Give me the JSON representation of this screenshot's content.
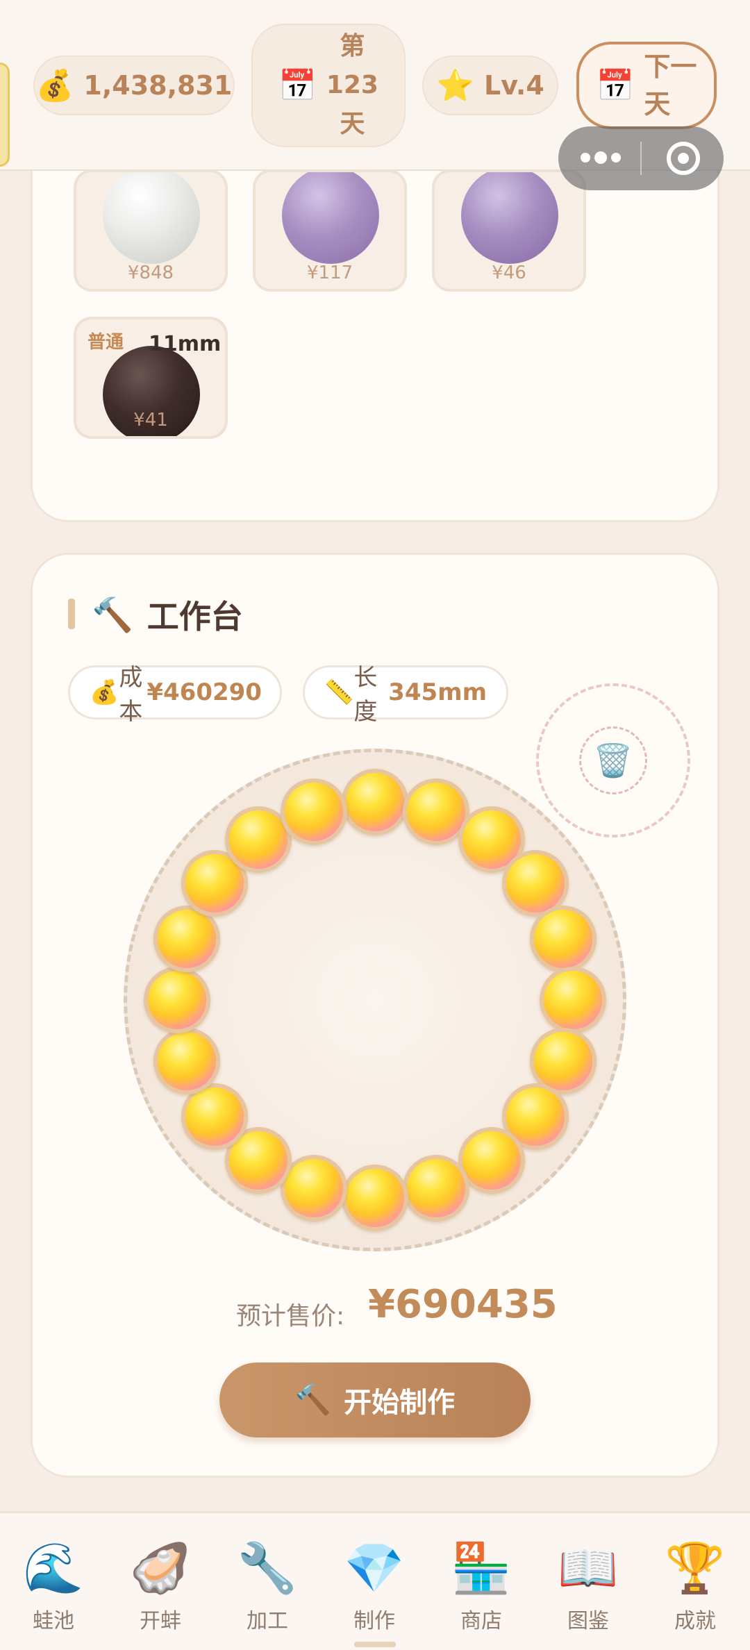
{
  "header": {
    "money": "1,438,831",
    "day_prefix": "第",
    "day_number": "123",
    "day_suffix": "天",
    "level": "Lv.4",
    "next_day_line1": "下一",
    "next_day_line2": "天",
    "icons": {
      "money": "money-bag-icon",
      "calendar": "calendar-icon",
      "star": "star-icon"
    }
  },
  "inventory": {
    "tiles": [
      {
        "price": "¥848",
        "color": "#d8d8d6"
      },
      {
        "price": "¥117",
        "color": "#a48bbd"
      },
      {
        "price": "¥46",
        "color": "#a38abd"
      },
      {
        "grade": "普通",
        "size": "11mm",
        "price": "¥41",
        "color": "#3e2c2a"
      }
    ]
  },
  "workbench": {
    "title": "工作台",
    "cost_label": "成本",
    "cost_value": "¥460290",
    "length_label": "长度",
    "length_value": "345mm",
    "bead_count": 20,
    "estimated_price_label": "预计售价:",
    "estimated_price_value": "¥690435",
    "make_button": "开始制作"
  },
  "nav": {
    "items": [
      {
        "label": "蛙池",
        "icon": "wave-icon",
        "glyph": "🌊"
      },
      {
        "label": "开蚌",
        "icon": "oyster-icon",
        "glyph": "🦪"
      },
      {
        "label": "加工",
        "icon": "wrench-icon",
        "glyph": "🔧"
      },
      {
        "label": "制作",
        "icon": "diamond-icon",
        "glyph": "💎"
      },
      {
        "label": "商店",
        "icon": "store-icon",
        "glyph": "🏪"
      },
      {
        "label": "图鉴",
        "icon": "book-icon",
        "glyph": "📖"
      },
      {
        "label": "成就",
        "icon": "trophy-icon",
        "glyph": "🏆"
      }
    ],
    "active_index": 3
  }
}
